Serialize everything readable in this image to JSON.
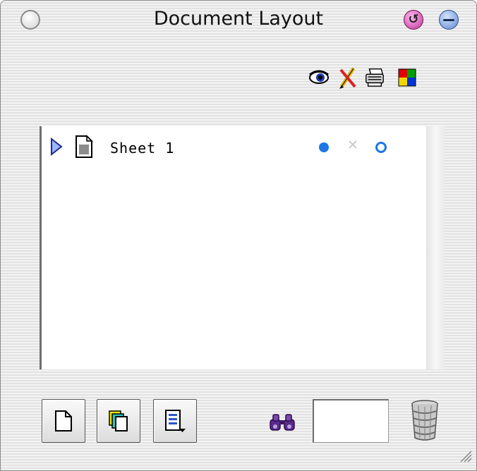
{
  "window": {
    "title": "Document Layout",
    "title_buttons": {
      "close": "close-button",
      "toolbar_toggle_glyph": "↺",
      "collapse": "collapse-button"
    }
  },
  "toolbar": {
    "icons": [
      "eye-icon",
      "pencil-eraser-icon",
      "printer-icon",
      "color-squares-icon"
    ]
  },
  "list": {
    "rows": [
      {
        "label": "Sheet 1",
        "expanded": false,
        "visible": true,
        "locked": false,
        "printable": true
      }
    ]
  },
  "bottom_bar": {
    "buttons": [
      "new-sheet-icon",
      "duplicate-sheet-icon",
      "sheet-options-icon"
    ],
    "search_value": "",
    "find_icon": "binoculars-icon",
    "trash_icon": "trash-icon"
  },
  "colors": {
    "accent_blue": "#1e77e6",
    "toolbar_button": "#c0329b",
    "collapse_button": "#5d87cf"
  }
}
